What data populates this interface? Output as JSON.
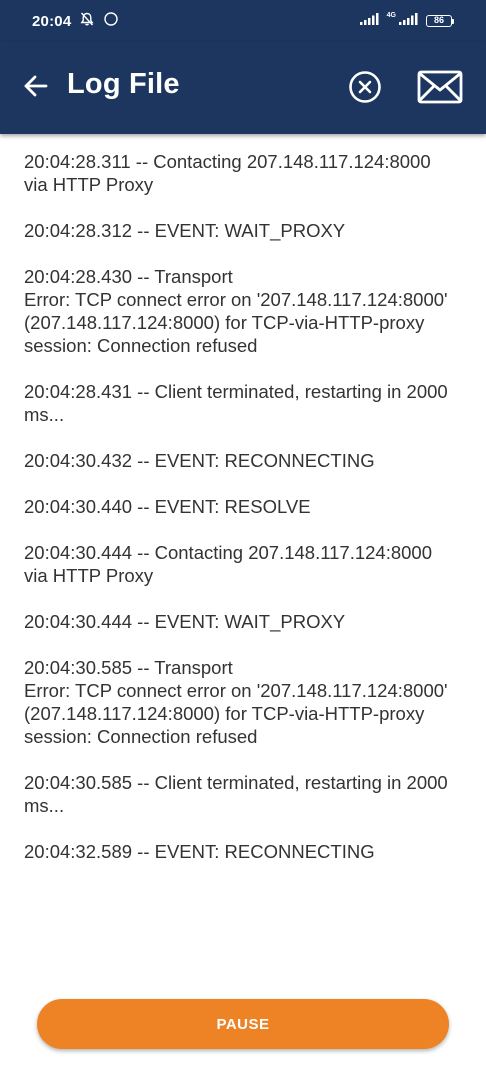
{
  "status_bar": {
    "time": "20:04",
    "network_type": "4G",
    "battery_level": "86",
    "icons": [
      "alarm-off-icon",
      "sync-circle-icon",
      "signal-icon",
      "signal-icon",
      "battery-icon"
    ]
  },
  "app_bar": {
    "title": "Log File",
    "back_icon": "arrow-left-icon",
    "clear_icon": "close-circle-icon",
    "mail_icon": "mail-icon"
  },
  "log_entries": [
    "20:04:28.311 -- Contacting 207.148.117.124:8000 via HTTP Proxy",
    "20:04:28.312 -- EVENT: WAIT_PROXY",
    "20:04:28.430 -- Transport\nError: TCP connect error on '207.148.117.124:8000' (207.148.117.124:8000) for TCP-via-HTTP-proxy session: Connection refused",
    "20:04:28.431 -- Client terminated, restarting in 2000 ms...",
    "20:04:30.432 -- EVENT: RECONNECTING",
    "20:04:30.440 -- EVENT: RESOLVE",
    "20:04:30.444 -- Contacting 207.148.117.124:8000 via HTTP Proxy",
    "20:04:30.444 -- EVENT: WAIT_PROXY",
    "20:04:30.585 -- Transport\nError: TCP connect error on '207.148.117.124:8000' (207.148.117.124:8000) for TCP-via-HTTP-proxy session: Connection refused",
    "20:04:30.585 -- Client terminated, restarting in 2000 ms...",
    "20:04:32.589 -- EVENT: RECONNECTING"
  ],
  "pause_button": {
    "label": "PAUSE"
  },
  "colors": {
    "app_bar": "#1c3660",
    "accent": "#ed8325",
    "log_text": "#333333"
  }
}
